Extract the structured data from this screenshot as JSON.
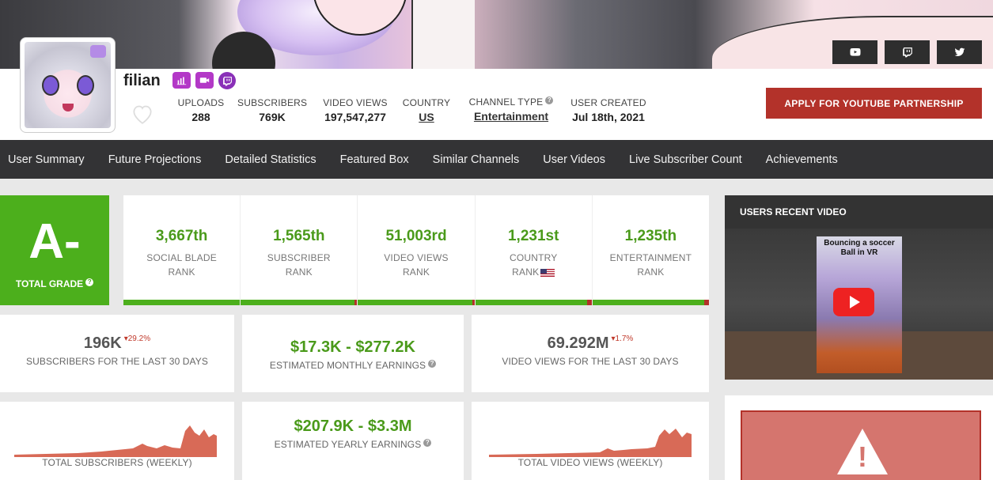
{
  "profile": {
    "username": "filian",
    "badges": [
      "stats-badge-icon",
      "video-badge-icon",
      "twitch-badge-icon"
    ]
  },
  "social": [
    "youtube-icon",
    "twitch-icon",
    "twitter-icon"
  ],
  "stats": {
    "uploads": {
      "label": "UPLOADS",
      "value": "288"
    },
    "subscribers": {
      "label": "SUBSCRIBERS",
      "value": "769K"
    },
    "video_views": {
      "label": "VIDEO VIEWS",
      "value": "197,547,277"
    },
    "country": {
      "label": "COUNTRY",
      "value": "US"
    },
    "channel_type": {
      "label": "CHANNEL TYPE",
      "value": "Entertainment"
    },
    "user_created": {
      "label": "USER CREATED",
      "value": "Jul 18th, 2021"
    }
  },
  "apply_button": "APPLY FOR YOUTUBE PARTNERSHIP",
  "nav": [
    "User Summary",
    "Future Projections",
    "Detailed Statistics",
    "Featured Box",
    "Similar Channels",
    "User Videos",
    "Live Subscriber Count",
    "Achievements"
  ],
  "grade": {
    "value": "A-",
    "label": "TOTAL GRADE"
  },
  "ranks": [
    {
      "num": "3,667th",
      "l1": "SOCIAL BLADE",
      "l2": "RANK",
      "bar_red_fraction": 0.0
    },
    {
      "num": "1,565th",
      "l1": "SUBSCRIBER",
      "l2": "RANK",
      "bar_red_fraction": 0.02
    },
    {
      "num": "51,003rd",
      "l1": "VIDEO VIEWS",
      "l2": "RANK",
      "bar_red_fraction": 0.02
    },
    {
      "num": "1,231st",
      "l1": "COUNTRY",
      "l2": "RANK",
      "bar_red_fraction": 0.04
    },
    {
      "num": "1,235th",
      "l1": "ENTERTAINMENT",
      "l2": "RANK",
      "bar_red_fraction": 0.04
    }
  ],
  "cards": {
    "subs30": {
      "value": "196K",
      "change": "29.2%",
      "label": "SUBSCRIBERS FOR THE LAST 30 DAYS"
    },
    "monthly": {
      "value": "$17.3K  -  $277.2K",
      "label": "ESTIMATED MONTHLY EARNINGS"
    },
    "views30": {
      "value": "69.292M",
      "change": "1.7%",
      "label": "VIDEO VIEWS FOR THE LAST 30 DAYS"
    },
    "total_subs": {
      "label": "TOTAL SUBSCRIBERS (WEEKLY)"
    },
    "yearly": {
      "value": "$207.9K  -  $3.3M",
      "label": "ESTIMATED YEARLY EARNINGS"
    },
    "total_views": {
      "label": "TOTAL VIDEO VIEWS (WEEKLY)"
    }
  },
  "video": {
    "panel_title": "USERS RECENT VIDEO",
    "caption": "Bouncing a soccer Ball in VR"
  },
  "colors": {
    "green": "#4caf1c",
    "red": "#b3322a",
    "nav": "#333335"
  }
}
